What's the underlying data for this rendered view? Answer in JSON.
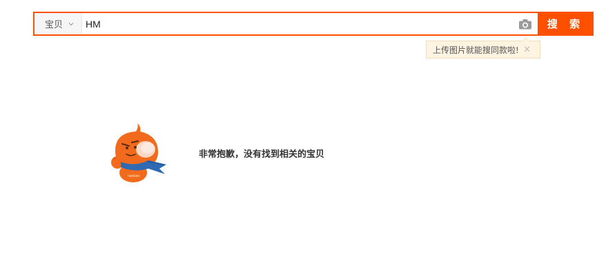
{
  "search": {
    "scope_label": "宝贝",
    "query_value": "HM",
    "button_label": "搜 索"
  },
  "tooltip": {
    "text": "上传图片就能搜同款啦!",
    "close_glyph": "×"
  },
  "empty_state": {
    "message": "非常抱歉，没有找到相关的宝贝",
    "mascot_badge": "taobao"
  },
  "colors": {
    "accent": "#ff5000",
    "tooltip_bg": "#fff3e2",
    "tooltip_border": "#f7dbb6",
    "mascot_orange": "#f26b1d",
    "mascot_scarf": "#2f6ab2"
  }
}
